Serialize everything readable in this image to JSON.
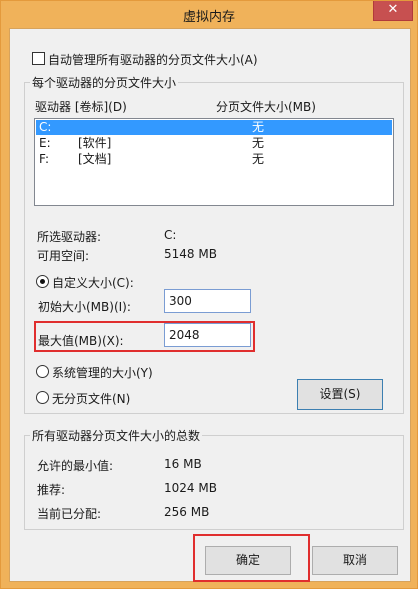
{
  "window": {
    "title": "虚拟内存",
    "close_glyph": "✕"
  },
  "auto_manage": {
    "label": "自动管理所有驱动器的分页文件大小(A)",
    "checked": false
  },
  "per_drive": {
    "group_title": "每个驱动器的分页文件大小",
    "col_drive": "驱动器 [卷标](D)",
    "col_size": "分页文件大小(MB)",
    "rows": [
      {
        "drive": "C:",
        "label": "",
        "size": "无",
        "selected": true
      },
      {
        "drive": "E:",
        "label": "[软件]",
        "size": "无",
        "selected": false
      },
      {
        "drive": "F:",
        "label": "[文档]",
        "size": "无",
        "selected": false
      }
    ],
    "selected_drive_label": "所选驱动器:",
    "selected_drive_value": "C:",
    "free_space_label": "可用空间:",
    "free_space_value": "5148 MB",
    "custom_size_label": "自定义大小(C):",
    "initial_size_label": "初始大小(MB)(I):",
    "initial_size_value": "300",
    "max_size_label": "最大值(MB)(X):",
    "max_size_value": "2048",
    "system_managed_label": "系统管理的大小(Y)",
    "no_paging_label": "无分页文件(N)",
    "set_button": "设置(S)"
  },
  "totals": {
    "group_title": "所有驱动器分页文件大小的总数",
    "min_allowed_label": "允许的最小值:",
    "min_allowed_value": "16 MB",
    "recommended_label": "推荐:",
    "recommended_value": "1024 MB",
    "current_label": "当前已分配:",
    "current_value": "256 MB"
  },
  "buttons": {
    "ok": "确定",
    "cancel": "取消"
  },
  "colors": {
    "highlight": "#e02e2e",
    "selection": "#3399ff"
  }
}
